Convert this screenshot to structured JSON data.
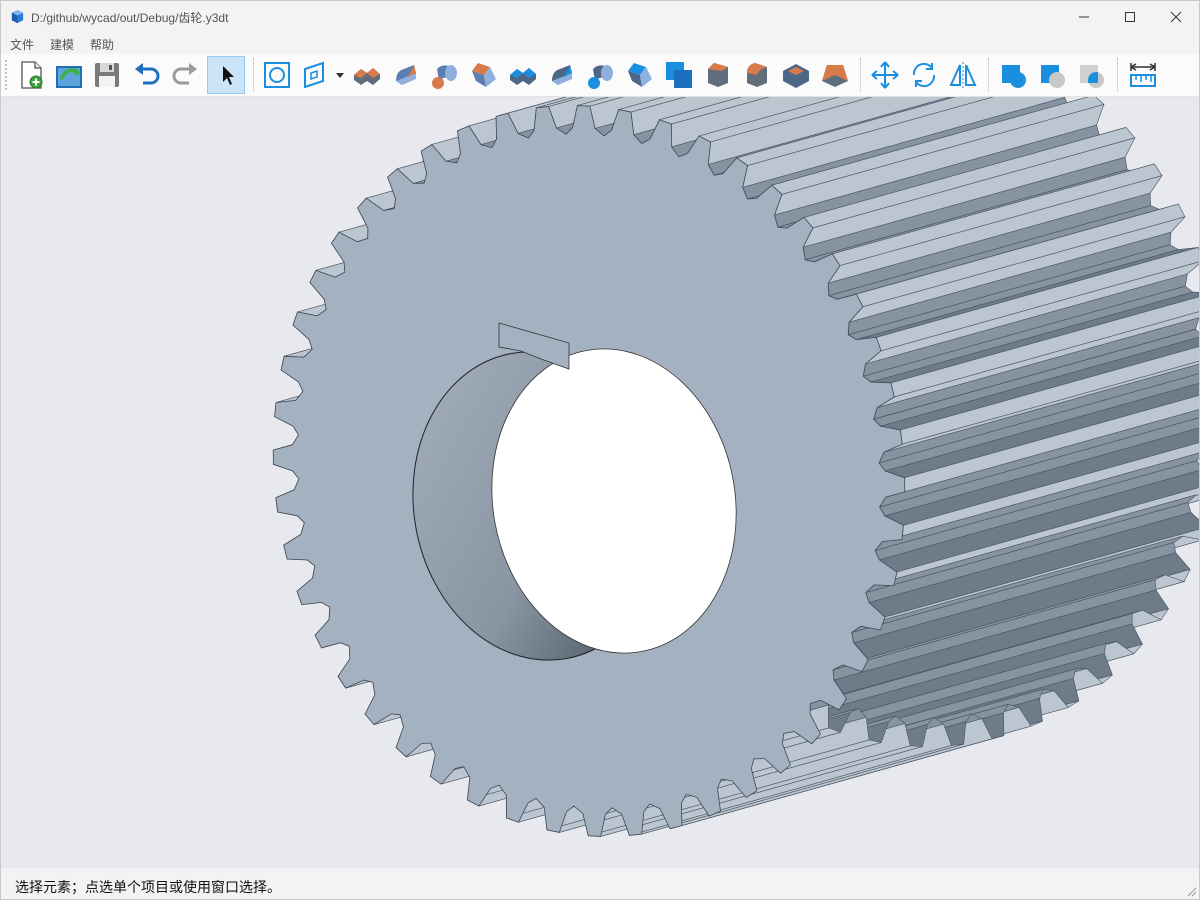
{
  "window": {
    "title": "D:/github/wycad/out/Debug/齿轮.y3dt"
  },
  "menu": {
    "file": "文件",
    "modeling": "建模",
    "help": "帮助"
  },
  "toolbar": {
    "buttons": [
      {
        "icon": "new-file-icon",
        "tip": ""
      },
      {
        "icon": "open-file-icon",
        "tip": ""
      },
      {
        "icon": "save-icon",
        "tip": ""
      },
      {
        "icon": "undo-icon",
        "tip": ""
      },
      {
        "icon": "redo-icon",
        "tip": ""
      },
      {
        "icon": "select-cursor-icon",
        "active": true
      },
      {
        "icon": "sketch-circle-icon"
      },
      {
        "icon": "sketch-plane-icon",
        "has_dropdown": true
      },
      {
        "icon": "extrude-icon"
      },
      {
        "icon": "revolve-icon"
      },
      {
        "icon": "sweep-icon"
      },
      {
        "icon": "loft-icon"
      },
      {
        "icon": "extrude-cut-icon"
      },
      {
        "icon": "revolve-cut-icon"
      },
      {
        "icon": "sweep-cut-icon"
      },
      {
        "icon": "loft-cut-icon"
      },
      {
        "icon": "boolean-union-icon"
      },
      {
        "icon": "chamfer-icon"
      },
      {
        "icon": "fillet-icon"
      },
      {
        "icon": "shell-icon"
      },
      {
        "icon": "draft-icon"
      },
      {
        "icon": "move-icon"
      },
      {
        "icon": "rotate-icon"
      },
      {
        "icon": "mirror-icon"
      },
      {
        "icon": "boolean-fuse-icon"
      },
      {
        "icon": "boolean-subtract-icon"
      },
      {
        "icon": "boolean-intersect-icon"
      },
      {
        "icon": "measure-distance-icon"
      }
    ]
  },
  "status": {
    "text": "选择元素；点选单个项目或使用窗口选择。"
  },
  "colors": {
    "viewport_bg": "#e8e9ee",
    "gear_face": "#a3b1c0",
    "gear_dark": "#5f6d7c",
    "accent_blue": "#1a8fe0",
    "accent_orange": "#d97a4a"
  }
}
